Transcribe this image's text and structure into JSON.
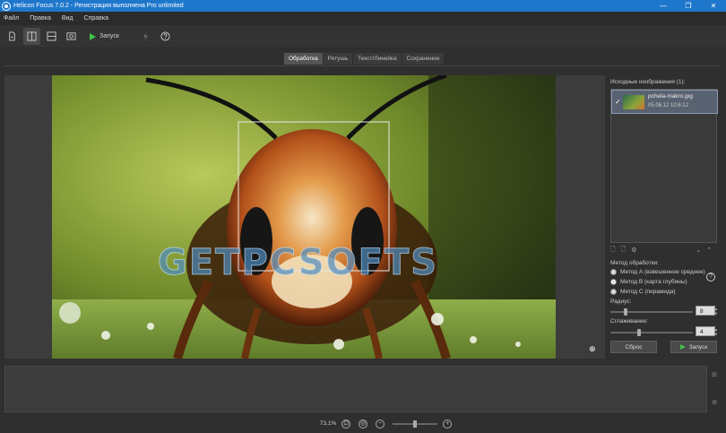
{
  "titlebar": {
    "title": "Helicon Focus 7.0.2 - Регистрация выполнена Pro unlimited",
    "minimize": "—",
    "maximize": "❐",
    "close": "✕"
  },
  "menu": [
    "Файл",
    "Правка",
    "Вид",
    "Справка"
  ],
  "toolbar": {
    "run_label": "Запуск"
  },
  "tabs": [
    "Обработка",
    "Ретушь",
    "Текст/Линейка",
    "Сохранение"
  ],
  "viewer": {
    "watermark": "GETPCSOFTS"
  },
  "right_panel": {
    "sources_title": "Исходные изображения (1):",
    "source_file": {
      "name": "pchela-makro.jpg",
      "date": "05.06.12 10:6:12"
    },
    "method_title": "Метод обработки:",
    "methods": [
      "Метод А (взвешенное среднее)",
      "Метод B (карта глубины)",
      "Метод C (пирамида)"
    ],
    "selected_method": 1,
    "radius_label": "Радиус:",
    "radius_value": "8",
    "smoothing_label": "Сглаживание:",
    "smoothing_value": "4",
    "reset_label": "Сброс",
    "run_label": "Запуск"
  },
  "status": {
    "zoom": "73.1%"
  }
}
